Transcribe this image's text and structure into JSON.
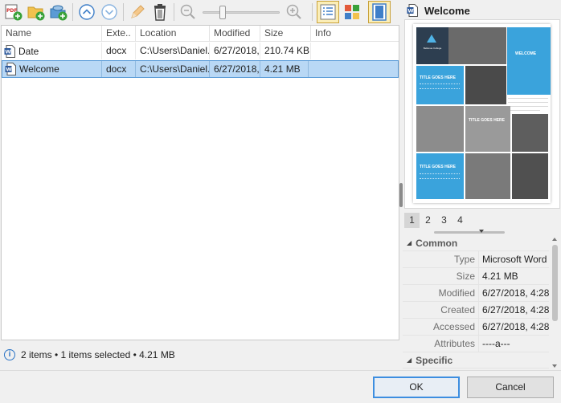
{
  "toolbar": {
    "buttons": [
      "add-pdf",
      "add-folder",
      "add-network-folder",
      "move-up",
      "move-down",
      "rename",
      "delete",
      "zoom-out",
      "zoom-in",
      "details-view",
      "thumbnails-view",
      "preview-pane"
    ],
    "pdf_badge": "PDF",
    "zoom_level": 0.25
  },
  "filelist": {
    "columns": [
      "Name",
      "Exte..",
      "Location",
      "Modified",
      "Size",
      "Info"
    ],
    "rows": [
      {
        "name": "Date",
        "ext": "docx",
        "location": "C:\\Users\\Daniel.F",
        "modified": "6/27/2018,",
        "size": "210.74 KB",
        "info": ""
      },
      {
        "name": "Welcome",
        "ext": "docx",
        "location": "C:\\Users\\Daniel.F",
        "modified": "6/27/2018,",
        "size": "4.21 MB",
        "info": ""
      }
    ]
  },
  "status": {
    "text": "2 items • 1 items selected • 4.21 MB"
  },
  "preview": {
    "title": "Welcome",
    "thumb_welcome": "WELCOME",
    "thumb_title": "TITLE GOES HERE",
    "thumb_college": "Bellevue College",
    "pages": [
      "1",
      "2",
      "3",
      "4"
    ]
  },
  "properties": {
    "groups": [
      {
        "label": "Common"
      },
      {
        "label": "Specific"
      }
    ],
    "rows": [
      {
        "key": "Type",
        "value": "Microsoft Word"
      },
      {
        "key": "Size",
        "value": "4.21 MB"
      },
      {
        "key": "Modified",
        "value": "6/27/2018, 4:28"
      },
      {
        "key": "Created",
        "value": "6/27/2018, 4:28"
      },
      {
        "key": "Accessed",
        "value": "6/27/2018, 4:28"
      },
      {
        "key": "Attributes",
        "value": "----a---"
      }
    ]
  },
  "buttons": {
    "ok": "OK",
    "cancel": "Cancel"
  },
  "colors": {
    "selection": "#b9d8f5",
    "accent": "#3aa3dc",
    "word_blue": "#2b579a"
  }
}
